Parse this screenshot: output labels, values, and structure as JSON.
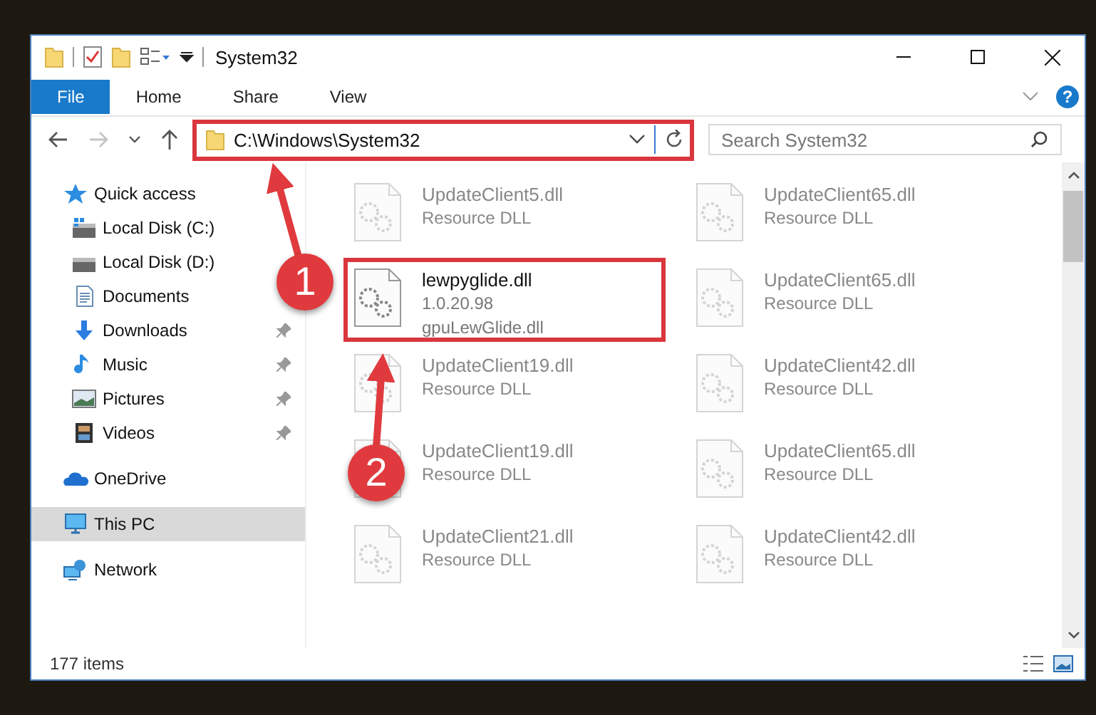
{
  "window": {
    "title": "System32"
  },
  "ribbon": {
    "tabs": [
      {
        "label": "File",
        "selected": true
      },
      {
        "label": "Home",
        "selected": false
      },
      {
        "label": "Share",
        "selected": false
      },
      {
        "label": "View",
        "selected": false
      }
    ],
    "help": "?"
  },
  "navigation": {
    "back_disabled": false,
    "forward_disabled": true
  },
  "address_bar": {
    "path": "C:\\Windows\\System32",
    "marked": true
  },
  "search": {
    "placeholder": "Search System32"
  },
  "sidebar": {
    "items": [
      {
        "label": "Quick access",
        "kind": "star",
        "selected": false,
        "children": [
          {
            "label": "Local Disk (C:)",
            "kind": "drive-c",
            "pinned": false,
            "selected": false
          },
          {
            "label": "Local Disk (D:)",
            "kind": "drive",
            "pinned": false,
            "selected": false
          },
          {
            "label": "Documents",
            "kind": "documents",
            "pinned": false,
            "selected": false
          },
          {
            "label": "Downloads",
            "kind": "downloads",
            "pinned": true,
            "selected": false
          },
          {
            "label": "Music",
            "kind": "music",
            "pinned": true,
            "selected": false
          },
          {
            "label": "Pictures",
            "kind": "pictures",
            "pinned": true,
            "selected": false
          },
          {
            "label": "Videos",
            "kind": "videos",
            "pinned": true,
            "selected": false
          }
        ]
      },
      {
        "label": "OneDrive",
        "kind": "cloud",
        "selected": false
      },
      {
        "label": "This PC",
        "kind": "pc",
        "selected": true
      },
      {
        "label": "Network",
        "kind": "network",
        "selected": false
      }
    ]
  },
  "files": [
    {
      "name": "UpdateClient5.dll",
      "lines": [
        "Resource DLL"
      ],
      "marked": false,
      "faded": true
    },
    {
      "name": "UpdateClient65.dll",
      "lines": [
        "Resource DLL"
      ],
      "marked": false,
      "faded": true
    },
    {
      "name": "lewpyglide.dll",
      "lines": [
        "1.0.20.98",
        "gpuLewGlide.dll"
      ],
      "marked": true,
      "faded": false
    },
    {
      "name": "UpdateClient65.dll",
      "lines": [
        "Resource DLL"
      ],
      "marked": false,
      "faded": true
    },
    {
      "name": "UpdateClient19.dll",
      "lines": [
        "Resource DLL"
      ],
      "marked": false,
      "faded": true
    },
    {
      "name": "UpdateClient42.dll",
      "lines": [
        "Resource DLL"
      ],
      "marked": false,
      "faded": true
    },
    {
      "name": "UpdateClient19.dll",
      "lines": [
        "Resource DLL"
      ],
      "marked": false,
      "faded": true
    },
    {
      "name": "UpdateClient65.dll",
      "lines": [
        "Resource DLL"
      ],
      "marked": false,
      "faded": true
    },
    {
      "name": "UpdateClient21.dll",
      "lines": [
        "Resource DLL"
      ],
      "marked": false,
      "faded": true
    },
    {
      "name": "UpdateClient42.dll",
      "lines": [
        "Resource DLL"
      ],
      "marked": false,
      "faded": true
    }
  ],
  "status_bar": {
    "item_count": "177 items"
  },
  "annotations": [
    {
      "number": "1"
    },
    {
      "number": "2"
    }
  ]
}
